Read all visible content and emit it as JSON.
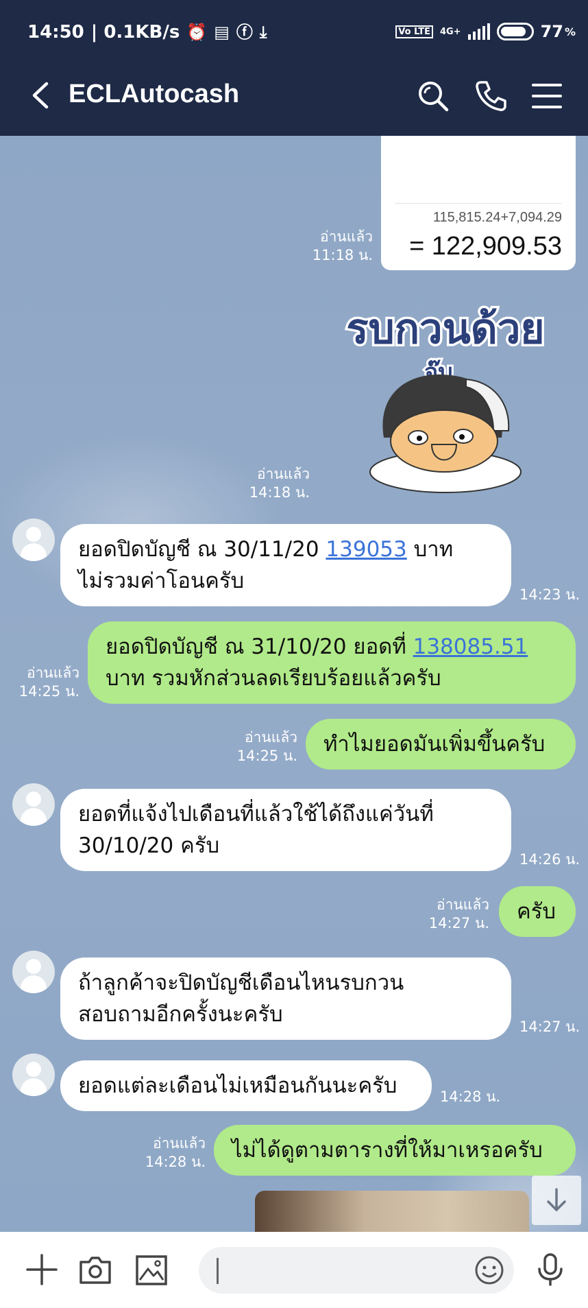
{
  "status_bar": {
    "time": "14:50",
    "network_speed": "| 0.1KB/s",
    "network_type": "4G+",
    "volte": "Vo LTE",
    "battery": "77",
    "battery_unit": "%"
  },
  "header": {
    "title": "ECLAutocash"
  },
  "messages": [
    {
      "id": "image",
      "read": "อ่านแล้ว",
      "time": "11:18 น.",
      "sub_text": "115,815.24+7,094.29",
      "total_text": "= 122,909.53"
    },
    {
      "id": "sticker",
      "read": "อ่านแล้ว",
      "time": "14:18 น.",
      "sticker_text_1": "รบกวนด้วย",
      "sticker_text_2": "จ๊บ"
    },
    {
      "id": "m1",
      "line1_a": "ยอดปิดบัญชี ณ 30/11/20 ",
      "line1_link": "139053",
      "line1_b": " บาท",
      "line2": "ไม่รวมค่าโอนครับ",
      "time": "14:23 น."
    },
    {
      "id": "m2",
      "line1_a": "ยอดปิดบัญชี ณ 31/10/20  ยอดที่ ",
      "line1_link": "138085.51",
      "line2": "บาท รวมหักส่วนลดเรียบร้อยแล้วครับ",
      "read": "อ่านแล้ว",
      "time": "14:25 น."
    },
    {
      "id": "m3",
      "text": "ทำไมยอดมันเพิ่มขึ้นครับ",
      "read": "อ่านแล้ว",
      "time": "14:25 น."
    },
    {
      "id": "m4",
      "line1": "ยอดที่แจ้งไปเดือนที่แล้วใช้ได้ถึงแค่วันที่",
      "line2": "30/10/20 ครับ",
      "time": "14:26 น."
    },
    {
      "id": "m5",
      "text": "ครับ",
      "read": "อ่านแล้ว",
      "time": "14:27 น."
    },
    {
      "id": "m6",
      "line1": "ถ้าลูกค้าจะปิดบัญชีเดือนไหนรบกวน",
      "line2": "สอบถามอีกครั้งนะครับ",
      "time": "14:27 น."
    },
    {
      "id": "m7",
      "text": "ยอดแต่ละเดือนไม่เหมือนกันนะครับ",
      "time": "14:28 น."
    },
    {
      "id": "m8",
      "text": "ไม่ได้ดูตามตารางที่ให้มาเหรอครับ",
      "read": "อ่านแล้ว",
      "time": "14:28 น."
    }
  ],
  "colors": {
    "header_bg": "#1e2a46",
    "incoming_bubble": "#ffffff",
    "outgoing_bubble": "#b1ea8a",
    "link": "#3b73d9"
  },
  "icons": [
    "back-arrow-icon",
    "search-icon",
    "phone-icon",
    "menu-icon",
    "plus-icon",
    "camera-icon",
    "gallery-icon",
    "emoji-icon",
    "microphone-icon",
    "scroll-down-icon"
  ]
}
